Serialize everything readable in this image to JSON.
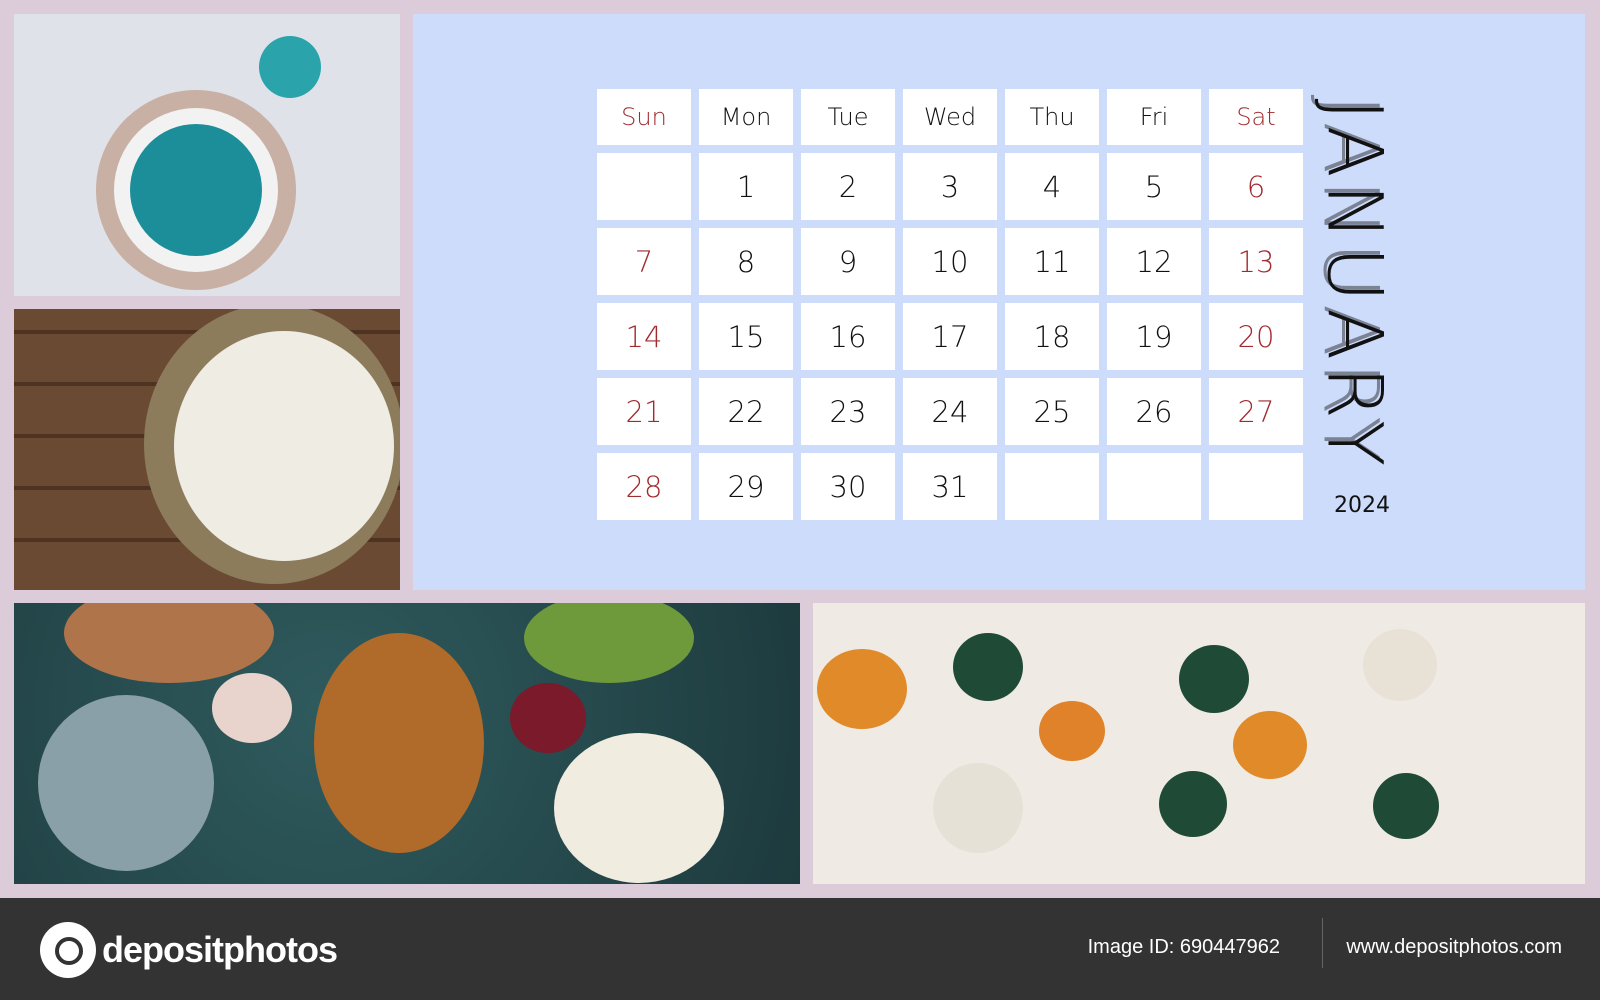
{
  "calendar": {
    "month": "JANUARY",
    "year": "2024",
    "weekdays": [
      "Sun",
      "Mon",
      "Tue",
      "Wed",
      "Thu",
      "Fri",
      "Sat"
    ],
    "weekend_color": "#a12a2e",
    "weeks": [
      [
        "",
        "1",
        "2",
        "3",
        "4",
        "5",
        "6"
      ],
      [
        "7",
        "8",
        "9",
        "10",
        "11",
        "12",
        "13"
      ],
      [
        "14",
        "15",
        "16",
        "17",
        "18",
        "19",
        "20"
      ],
      [
        "21",
        "22",
        "23",
        "24",
        "25",
        "26",
        "27"
      ],
      [
        "28",
        "29",
        "30",
        "31",
        "",
        "",
        ""
      ]
    ]
  },
  "photos": [
    "table-setting-teal-plate",
    "rustic-plate-cutlery",
    "roast-turkey-dinner",
    "pumpkin-table-decor"
  ],
  "footer": {
    "brand": "depositphotos",
    "image_id": "Image ID: 690447962",
    "site": "www.depositphotos.com"
  }
}
